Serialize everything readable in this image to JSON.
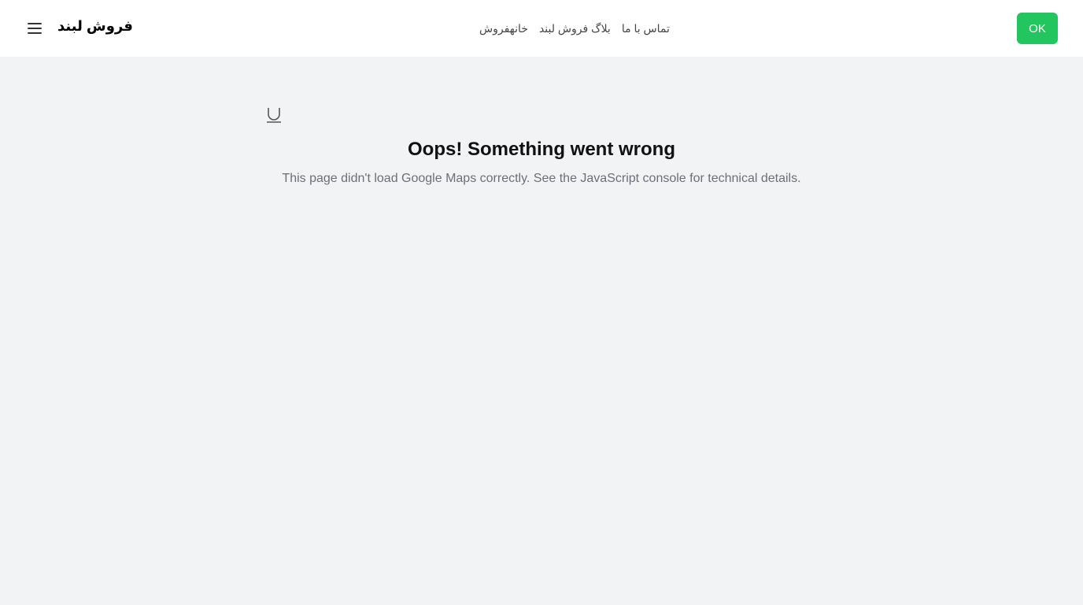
{
  "header": {
    "brand": "فروش لبند",
    "nav": [
      {
        "label": "خانهفروش"
      },
      {
        "label": "بلاگ فروش لبند"
      },
      {
        "label": "تماس با ما"
      }
    ],
    "ok_label": "OK",
    "ok_color": "#22c55e"
  },
  "error": {
    "icon": "union-icon",
    "title": "Oops! Something went wrong",
    "message": "This page didn't load Google Maps correctly. See the JavaScript console for technical details."
  }
}
